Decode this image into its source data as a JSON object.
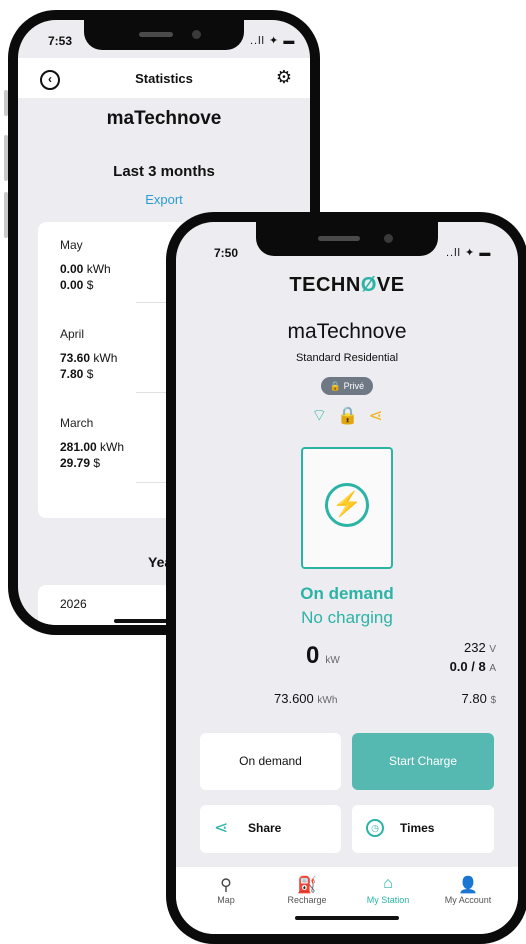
{
  "back_screen": {
    "status": {
      "time": "7:53",
      "icons": "..ll ✦ ▬"
    },
    "header": {
      "title": "Statistics",
      "back_icon": "arrow-left-circle-icon",
      "settings_icon": "gear-icon"
    },
    "station_name": "maTechnove",
    "period_title": "Last 3 months",
    "export_label": "Export",
    "months": [
      {
        "name": "May",
        "energy": "0.00",
        "energy_unit": "kWh",
        "cost": "0.00",
        "cost_unit": "$"
      },
      {
        "name": "April",
        "energy": "73.60",
        "energy_unit": "kWh",
        "cost": "7.80",
        "cost_unit": "$"
      },
      {
        "name": "March",
        "energy": "281.00",
        "energy_unit": "kWh",
        "cost": "29.79",
        "cost_unit": "$"
      }
    ],
    "year_section_title": "Yea",
    "year": "2026"
  },
  "front_screen": {
    "status": {
      "time": "7:50",
      "icons": "..ll ✦ ▬"
    },
    "brand": {
      "part1": "TECHN",
      "part2": "Ø",
      "part3": "VE"
    },
    "station_name": "maTechnove",
    "station_type": "Standard Residential",
    "privacy_badge": "Privé",
    "status_icons": [
      "wifi-icon",
      "lock-icon",
      "share-icon"
    ],
    "charge_mode": "On demand",
    "charge_state": "No charging",
    "power": {
      "value": "0",
      "unit": "kW"
    },
    "voltage": {
      "value": "232",
      "unit": "V"
    },
    "current": {
      "value": "0.0 / 8",
      "unit": "A"
    },
    "energy": {
      "value": "73.600",
      "unit": "kWh"
    },
    "cost": {
      "value": "7.80",
      "unit": "$"
    },
    "buttons": {
      "on_demand": "On demand",
      "start_charge": "Start Charge",
      "share": "Share",
      "times": "Times"
    },
    "nav": [
      {
        "label": "Map",
        "icon": "map-pin-icon"
      },
      {
        "label": "Recharge",
        "icon": "charging-station-icon"
      },
      {
        "label": "My Station",
        "icon": "home-icon"
      },
      {
        "label": "My Account",
        "icon": "user-icon"
      }
    ],
    "accent_color": "#2bb3a6"
  }
}
